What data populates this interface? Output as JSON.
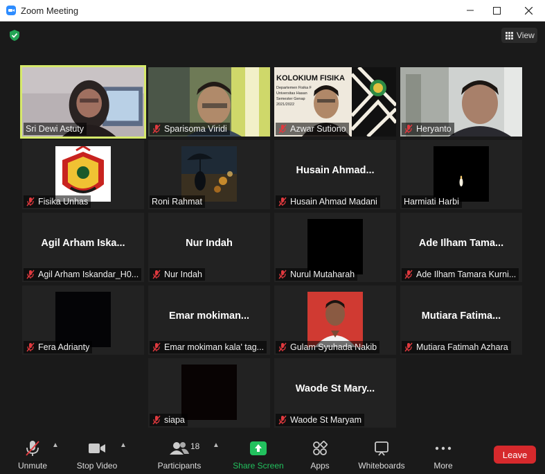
{
  "window": {
    "title": "Zoom Meeting"
  },
  "topbar": {
    "view_label": "View"
  },
  "participants": [
    {
      "name": "Sri Dewi Astuty",
      "display": "",
      "muted": false,
      "active_speaker": true
    },
    {
      "name": "Sparisoma Viridi",
      "display": "",
      "muted": true,
      "active_speaker": false
    },
    {
      "name": "Azwar Sutiono",
      "display": "",
      "muted": true,
      "active_speaker": false
    },
    {
      "name": "Heryanto",
      "display": "",
      "muted": true,
      "active_speaker": false
    },
    {
      "name": "Fisika Unhas",
      "display": "",
      "muted": true,
      "active_speaker": false
    },
    {
      "name": "Roni Rahmat",
      "display": "",
      "muted": false,
      "active_speaker": false
    },
    {
      "name": "Husain Ahmad Madani",
      "display": "Husain  Ahmad...",
      "muted": true,
      "active_speaker": false
    },
    {
      "name": "Harmiati Harbi",
      "display": "",
      "muted": false,
      "active_speaker": false
    },
    {
      "name": "Agil Arham Iskandar_H0...",
      "display": "Agil  Arham  Iska...",
      "muted": true,
      "active_speaker": false
    },
    {
      "name": "Nur Indah",
      "display": "Nur Indah",
      "muted": true,
      "active_speaker": false
    },
    {
      "name": "Nurul Mutaharah",
      "display": "",
      "muted": true,
      "active_speaker": false
    },
    {
      "name": "Ade Ilham Tamara Kurni...",
      "display": "Ade  Ilham  Tama...",
      "muted": true,
      "active_speaker": false
    },
    {
      "name": "Fera Adrianty",
      "display": "",
      "muted": true,
      "active_speaker": false
    },
    {
      "name": "Emar mokiman kala' tag...",
      "display": "Emar  mokiman...",
      "muted": true,
      "active_speaker": false
    },
    {
      "name": "Gulam Syuhada Nakib",
      "display": "",
      "muted": true,
      "active_speaker": false
    },
    {
      "name": "Mutiara Fatimah Azhara",
      "display": "Mutiara  Fatima...",
      "muted": true,
      "active_speaker": false
    },
    {
      "name": "siapa",
      "display": "",
      "muted": true,
      "active_speaker": false
    },
    {
      "name": "Waode St Maryam",
      "display": "Waode  St  Mary...",
      "muted": true,
      "active_speaker": false
    }
  ],
  "slide": {
    "title": "KOLOKIUM FISIKA",
    "lines": [
      "Departemen Fisika F",
      "Universitas Hasan",
      "Semester Genap",
      "2021/2022"
    ]
  },
  "toolbar": {
    "unmute": "Unmute",
    "stop_video": "Stop Video",
    "participants": "Participants",
    "participants_count": "18",
    "share_screen": "Share Screen",
    "apps": "Apps",
    "whiteboards": "Whiteboards",
    "more": "More",
    "leave": "Leave"
  },
  "colors": {
    "active_border": "#d6e96b",
    "share_green": "#22c15e",
    "leave_red": "#d6292c",
    "muted_red": "#e0393e"
  }
}
